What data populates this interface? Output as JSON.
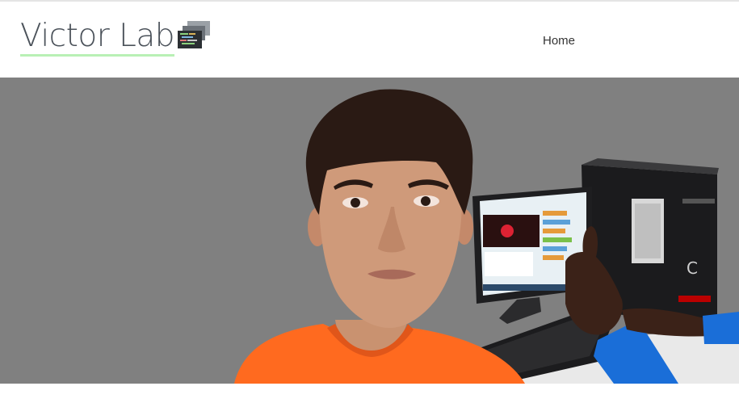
{
  "site": {
    "title": "Victor Lab",
    "logo_icon": "code-screens-icon"
  },
  "nav": {
    "items": [
      {
        "label": "Home"
      }
    ]
  },
  "hero": {
    "image": "boy-with-computer-thumbs-up",
    "background": "#808080"
  },
  "colors": {
    "title_text": "#4b525a",
    "title_underline": "#b9f0b5",
    "shirt": "#ff6a1f",
    "sleeve": "#1a6ed8"
  }
}
